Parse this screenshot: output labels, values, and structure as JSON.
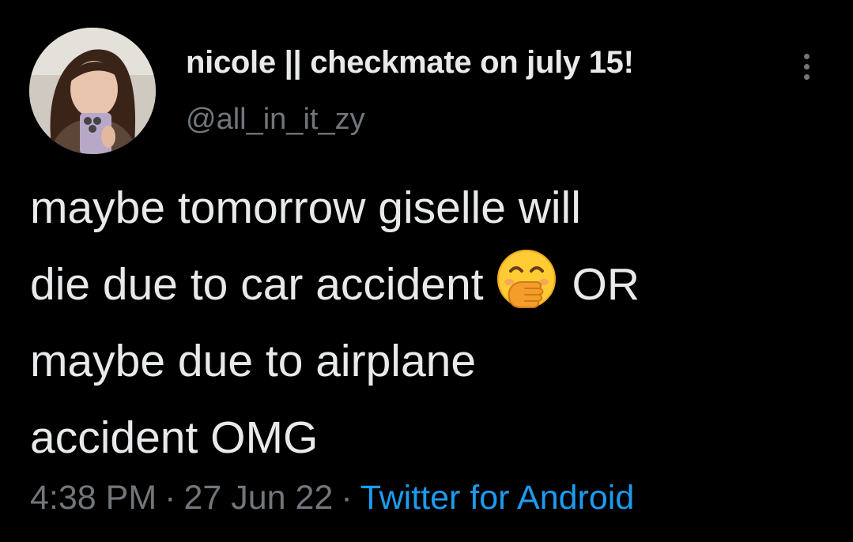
{
  "author": {
    "display_name": "nicole || checkmate on july 15!",
    "handle": "@all_in_it_zy",
    "avatar_icon": "profile-photo"
  },
  "more_menu_icon": "vertical-ellipsis-icon",
  "tweet": {
    "lines": [
      "maybe tomorrow giselle will",
      "die due to car accident",
      "OR",
      "maybe due to airplane",
      "accident OMG"
    ],
    "emoji": "face-with-hand-over-mouth"
  },
  "meta": {
    "time": "4:38 PM",
    "separator": "·",
    "date": "27 Jun 22",
    "source": "Twitter for Android"
  },
  "colors": {
    "background": "#000000",
    "primary_text": "#e7e9ea",
    "secondary_text": "#71767b",
    "link": "#1d9bf0"
  }
}
